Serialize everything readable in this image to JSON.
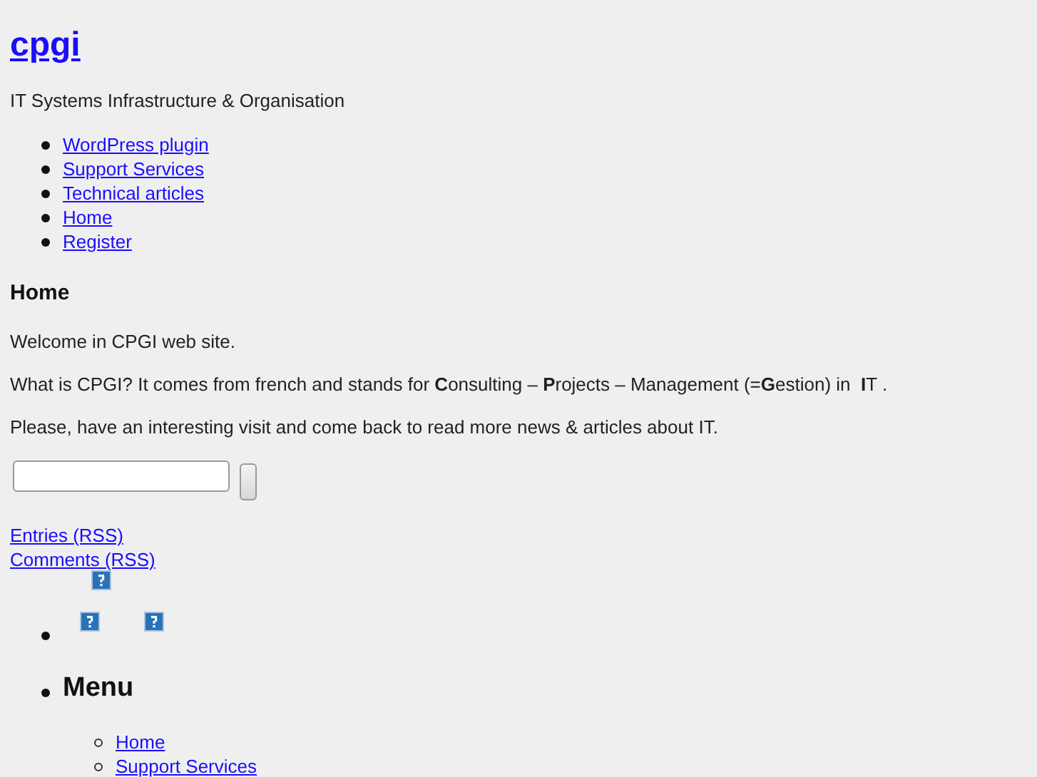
{
  "site_title": "cpgi",
  "tagline": "IT Systems Infrastructure & Organisation",
  "nav": [
    "WordPress plugin",
    "Support Services",
    "Technical articles",
    "Home",
    "Register"
  ],
  "page": {
    "heading": "Home",
    "paragraphs": [
      "Welcome in CPGI web site.",
      "What is CPGI? It comes from french and stands for **C**onsulting – **P**rojects – Management (=**G**estion) in  **I**T .",
      "Please, have an interesting visit and come back to read more news & articles about IT."
    ]
  },
  "feeds": [
    "Entries (RSS)",
    "Comments (RSS)"
  ],
  "menu": {
    "heading": "Menu",
    "items": [
      "Home",
      "Support Services"
    ]
  }
}
